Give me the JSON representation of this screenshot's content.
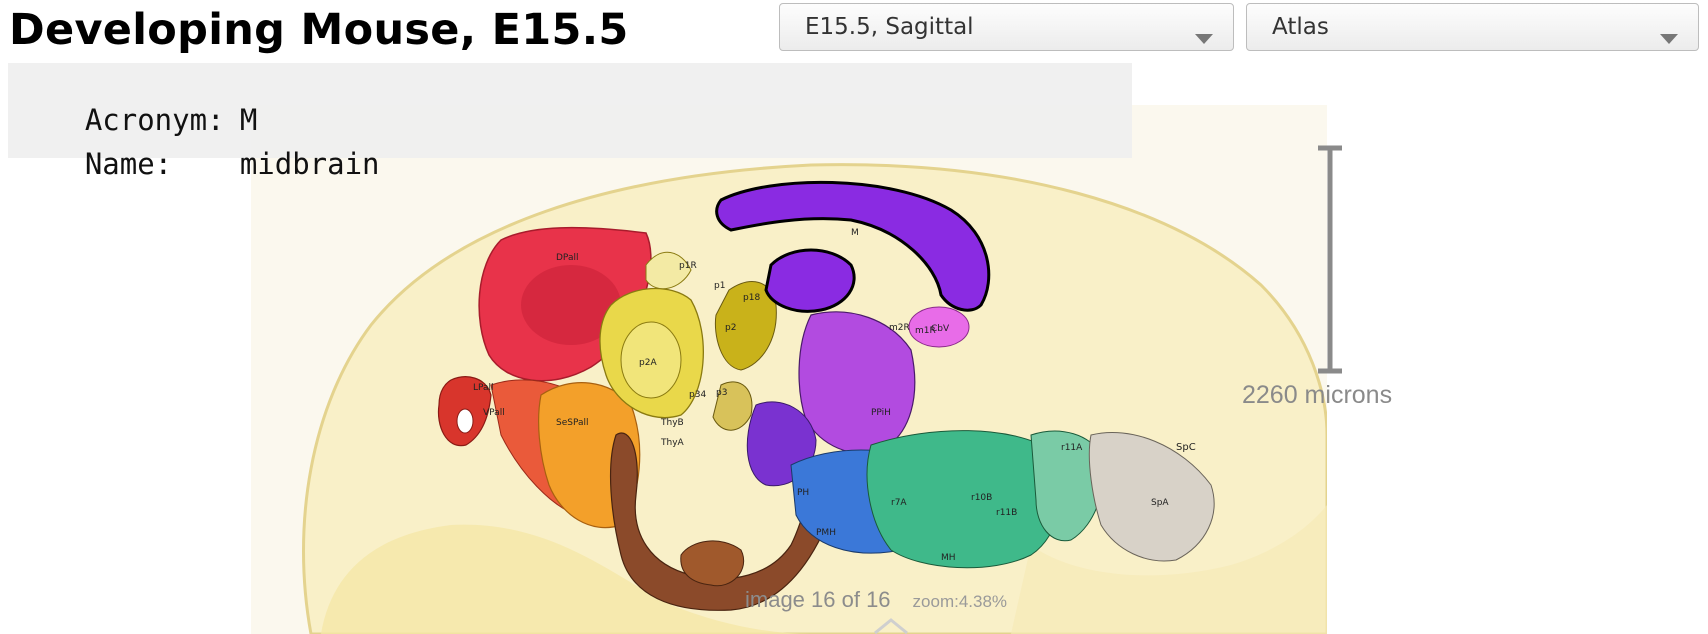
{
  "page_title": "Developing Mouse, E15.5",
  "dropdowns": {
    "view": {
      "selected": "E15.5, Sagittal",
      "icon": "chevron-down-icon"
    },
    "layer": {
      "selected": "Atlas",
      "icon": "chevron-down-icon"
    }
  },
  "info": {
    "acronym_label": "Acronym:",
    "acronym_value": "M",
    "name_label": "Name:",
    "name_value": "midbrain"
  },
  "scale_bar": {
    "label": "2260 microns"
  },
  "status": {
    "image_counter": "image 16 of 16",
    "zoom": "zoom:4.38%"
  },
  "atlas_labels": {
    "m": "M",
    "p1": "p1",
    "p2": "p2",
    "p3": "p3",
    "p1r": "p1R",
    "p2a": "p2A",
    "p34": "p34",
    "p18": "p18",
    "m2r": "m2R",
    "m1r": "m1R",
    "cbv": "CbV",
    "ppih": "PPiH",
    "ph": "PH",
    "pmh": "PMH",
    "mh": "MH",
    "spc": "SpC",
    "spa": "SpA",
    "sespall": "SeSPall",
    "dpall": "DPall",
    "lpall": "LPall",
    "vpall": "VPall",
    "r11a": "r11A",
    "thyb": "ThyB",
    "thya": "ThyA",
    "r7a": "r7A",
    "r10b": "r10B",
    "r11b": "r11B"
  },
  "colors": {
    "highlight_midbrain": "#8a2be2",
    "pallium_red": "#e8334a",
    "subpallium_orange": "#f3a02a",
    "diencephalon_yellow": "#e9d84a",
    "hypothalamus_brown": "#8b4a2a",
    "tegmentum_purple": "#b24be0",
    "hindbrain_teal": "#3fb98a",
    "hindbrain_blue": "#3b78d8",
    "spinal_grey": "#d8d2c8",
    "cerebellum_pink": "#e86ce8",
    "tissue_bg": "#f9f0c8"
  }
}
